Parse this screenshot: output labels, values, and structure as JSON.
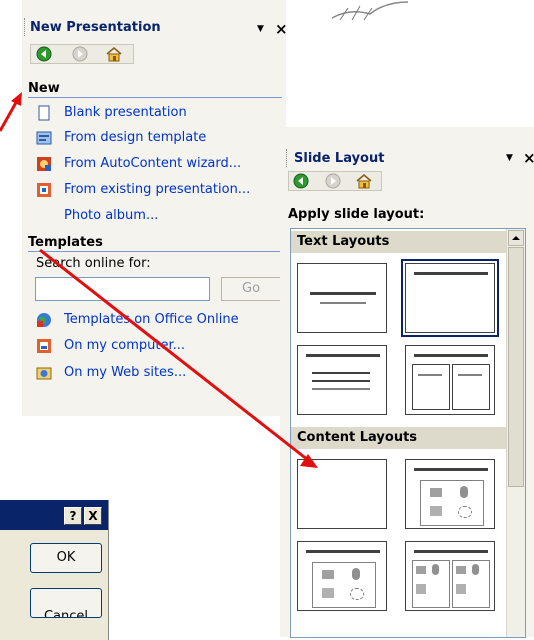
{
  "new_presentation_pane": {
    "title": "New Presentation",
    "section_new": "New",
    "items": [
      {
        "label": "Blank presentation",
        "icon": "blank-page-icon"
      },
      {
        "label": "From design template",
        "icon": "design-template-icon"
      },
      {
        "label": "From AutoContent wizard...",
        "icon": "wizard-icon"
      },
      {
        "label": "From existing presentation...",
        "icon": "existing-presentation-icon"
      },
      {
        "label": "Photo album...",
        "icon": ""
      }
    ],
    "section_templates": "Templates",
    "search_label": "Search online for:",
    "search_value": "",
    "go_label": "Go",
    "template_links": [
      {
        "label": "Templates on Office Online",
        "icon": "globe-icon"
      },
      {
        "label": "On my computer...",
        "icon": "computer-templates-icon"
      },
      {
        "label": "On my Web sites...",
        "icon": "web-sites-icon"
      }
    ]
  },
  "slide_layout_pane": {
    "title": "Slide Layout",
    "apply_label": "Apply slide layout:",
    "group_text": "Text Layouts",
    "group_content": "Content Layouts"
  },
  "dialog": {
    "help_label": "?",
    "close_label": "X",
    "ok_label": "OK",
    "cancel_label": "Cancel"
  },
  "colors": {
    "arrow": "#e01010",
    "link": "#0033cc",
    "header": "#0a246a"
  }
}
